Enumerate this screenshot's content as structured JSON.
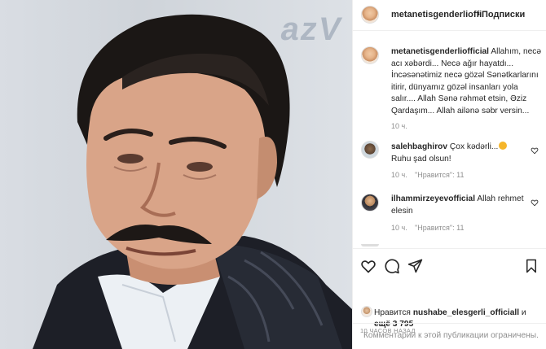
{
  "post": {
    "background_text": "azV"
  },
  "header": {
    "username": "metanetisgenderlioffi",
    "dot": "•",
    "follow_label": "Подписки"
  },
  "caption": {
    "username": "metanetisgenderliofficial",
    "text": "Allahım, necə acı xəbərdi... Necə ağır hayatdı... İncəsənətimiz necə gözəl Sənətkarlarını itirir, dünyamız gözəl insanları yola salır.... Allah Sənə rəhmət etsin, Əziz Qardaşım... Allah ailənə səbr versin...",
    "time": "10 ч."
  },
  "comments": [
    {
      "username": "salehbaghirov",
      "text_before": "Çox kədərli...",
      "text_after": "Ruhu şad olsun!",
      "time": "10 ч.",
      "likes": "\"Нравится\": 11"
    },
    {
      "username": "ilhammirzeyevofficial",
      "text": "Allah rehmet elesin",
      "time": "10 ч.",
      "likes": "\"Нравится\": 11"
    }
  ],
  "likes": {
    "prefix": "Нравится",
    "user": "nushabe_elesgerli_officiall",
    "suffix": "и",
    "others": "ещё 3 795"
  },
  "timestamp": "10 ЧАСОВ НАЗАД",
  "comments_disabled": "Комментарии к этой публикации ограничены."
}
